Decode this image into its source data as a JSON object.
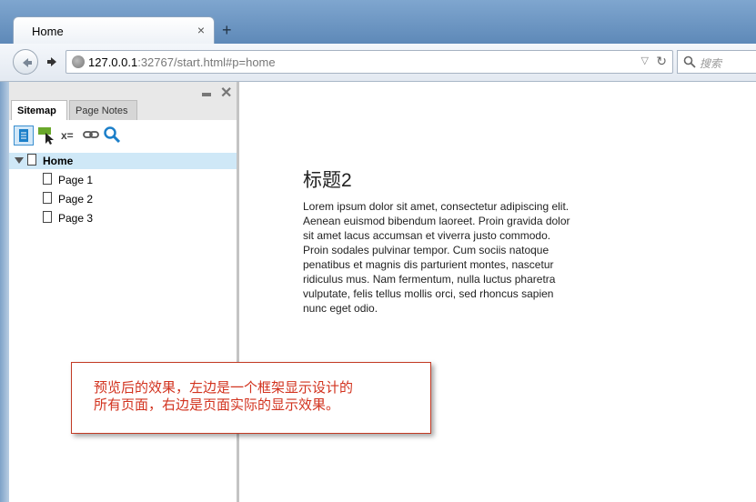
{
  "browser": {
    "tab_title": "Home",
    "tab_close": "×",
    "new_tab": "+",
    "url_host": "127.0.0.1",
    "url_rest": ":32767/start.html#p=home",
    "search_placeholder": "搜索"
  },
  "sidebar": {
    "tabs": [
      "Sitemap",
      "Page Notes"
    ],
    "toolbar_text": "x=",
    "tree": [
      {
        "label": "Home",
        "selected": true
      },
      {
        "label": "Page 1"
      },
      {
        "label": "Page 2"
      },
      {
        "label": "Page 3"
      }
    ]
  },
  "content": {
    "heading": "标题2",
    "paragraph": "Lorem ipsum dolor sit amet, consectetur adipiscing elit. Aenean euismod bibendum laoreet. Proin gravida dolor sit amet lacus accumsan et viverra justo commodo. Proin sodales pulvinar tempor. Cum sociis natoque penatibus et magnis dis parturient montes, nascetur ridiculus mus. Nam fermentum, nulla luctus pharetra vulputate, felis tellus mollis orci, sed rhoncus sapien nunc eget odio."
  },
  "callout": {
    "line1": "预览后的效果，左边是一个框架显示设计的",
    "line2": "所有页面，右边是页面实际的显示效果。"
  },
  "colors": {
    "accent": "#3a8fd0",
    "callout": "#d2321e"
  }
}
